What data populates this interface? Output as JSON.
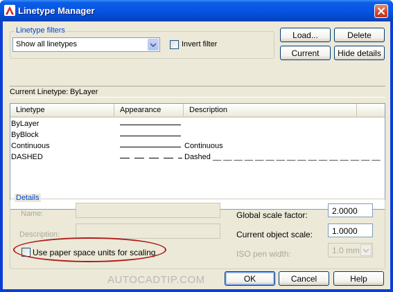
{
  "window": {
    "title": "Linetype Manager",
    "icon": "autocad-icon",
    "close_icon": "close-icon"
  },
  "filters": {
    "group_label": "Linetype filters",
    "selected": "Show all linetypes",
    "invert_label": "Invert filter",
    "invert_checked": false
  },
  "buttons": {
    "load": "Load...",
    "delete": "Delete",
    "current": "Current",
    "hide_details": "Hide details",
    "ok": "OK",
    "cancel": "Cancel",
    "help": "Help"
  },
  "current_linetype": {
    "label": "Current Linetype:",
    "value": "ByLayer"
  },
  "list": {
    "columns": [
      "Linetype",
      "Appearance",
      "Description"
    ],
    "rows": [
      {
        "name": "ByLayer",
        "appearance": "solid",
        "description": ""
      },
      {
        "name": "ByBlock",
        "appearance": "solid",
        "description": ""
      },
      {
        "name": "Continuous",
        "appearance": "solid",
        "description": "Continuous"
      },
      {
        "name": "DASHED",
        "appearance": "dashed",
        "description": "Dashed __ __ __ __ __ __ __ __ __ __ __ __ __ __ __ __"
      }
    ]
  },
  "details": {
    "group_label": "Details",
    "name_label": "Name:",
    "description_label": "Description:",
    "paper_space_label": "Use paper space units for scaling",
    "paper_space_checked": false,
    "global_scale_label": "Global scale factor:",
    "global_scale_value": "2.0000",
    "object_scale_label": "Current object scale:",
    "object_scale_value": "1.0000",
    "iso_pen_label": "ISO pen width:",
    "iso_pen_value": "1.0 mm"
  },
  "watermark": "AUTOCADTIP.COM",
  "colors": {
    "accent_blue": "#0046d5",
    "highlight_red": "#b01c1c",
    "titlebar": "#0854e2"
  }
}
